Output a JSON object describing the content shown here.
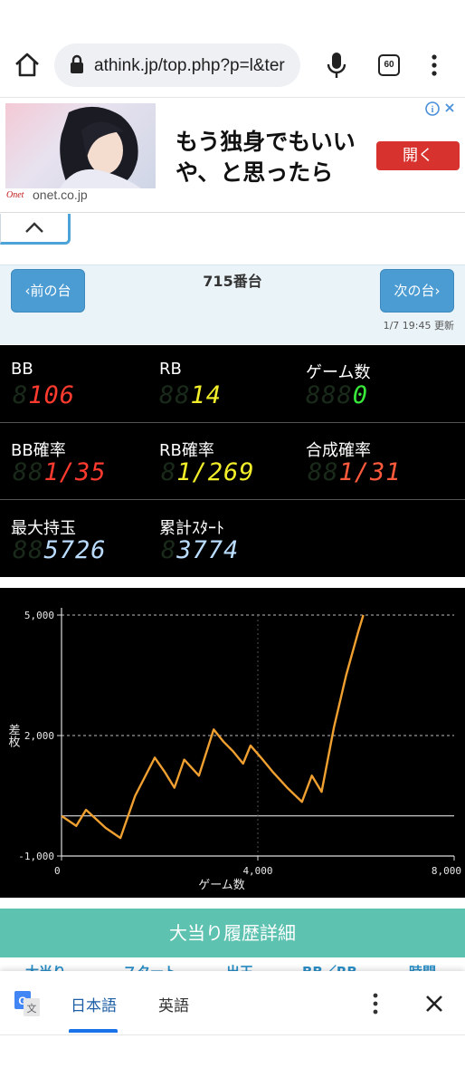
{
  "browser": {
    "url": "athink.jp/top.php?p=l&ter",
    "tab_count": "60",
    "icons": [
      "home-icon",
      "lock-icon",
      "mic-icon",
      "tab-switcher-icon",
      "more-icon"
    ]
  },
  "ad": {
    "headline_line1": "もう独身でもいい",
    "headline_line2": "や、と思ったら",
    "button": "開く",
    "brand": "Onet",
    "domain": "onet.co.jp",
    "colors": {
      "button": "#d8322e"
    }
  },
  "machine": {
    "prev": "‹前の台",
    "next": "次の台›",
    "title": "715番台",
    "updated": "1/7 19:45 更新"
  },
  "stats": {
    "bb": {
      "label": "BB",
      "value": "106",
      "color": "#ff3b2f"
    },
    "rb": {
      "label": "RB",
      "value": "14",
      "color": "#f2ee2a"
    },
    "games": {
      "label": "ゲーム数",
      "value": "0",
      "color": "#38e83a"
    },
    "bb_rate": {
      "label": "BB確率",
      "value": "1/35",
      "color": "#ff3b2f"
    },
    "rb_rate": {
      "label": "RB確率",
      "value": "1/269",
      "color": "#f2ee2a"
    },
    "combined_rate": {
      "label": "合成確率",
      "value": "1/31",
      "color": "#ff5a3c"
    },
    "max_balls": {
      "label": "最大持玉",
      "value": "5726",
      "color": "#b9dcff"
    },
    "total_starts": {
      "label": "累計ｽﾀｰﾄ",
      "value": "3774",
      "color": "#b9dcff"
    }
  },
  "chart_data": {
    "type": "line",
    "xlabel": "ゲーム数",
    "ylabel": "差枚",
    "xlim": [
      0,
      8000
    ],
    "ylim": [
      -1000,
      5000
    ],
    "x_ticks": [
      "0",
      "4,000",
      "8,000"
    ],
    "y_ticks": [
      "5,000",
      "2,000",
      "-1,000"
    ],
    "grid": true,
    "line_color": "#f0a030",
    "series": [
      {
        "x": [
          0,
          300,
          500,
          900,
          1200,
          1500,
          1900,
          2100,
          2300,
          2500,
          2800,
          3100,
          3300,
          3500,
          3700,
          3850,
          4100,
          4300,
          4600,
          4900,
          5100,
          5300,
          5550,
          5800,
          6050,
          6150
        ],
        "y": [
          0,
          -250,
          150,
          -300,
          -550,
          500,
          1450,
          1100,
          700,
          1400,
          1000,
          2150,
          1850,
          1600,
          1300,
          1750,
          1400,
          1100,
          700,
          350,
          1000,
          600,
          2200,
          3500,
          4600,
          5000
        ]
      }
    ]
  },
  "detail_button": "大当り履歴詳細",
  "peek_headers": [
    "大当り",
    "スタート",
    "出玉",
    "BB／RB",
    "時間"
  ],
  "translate": {
    "lang_source": "日本語",
    "lang_target": "英語"
  }
}
